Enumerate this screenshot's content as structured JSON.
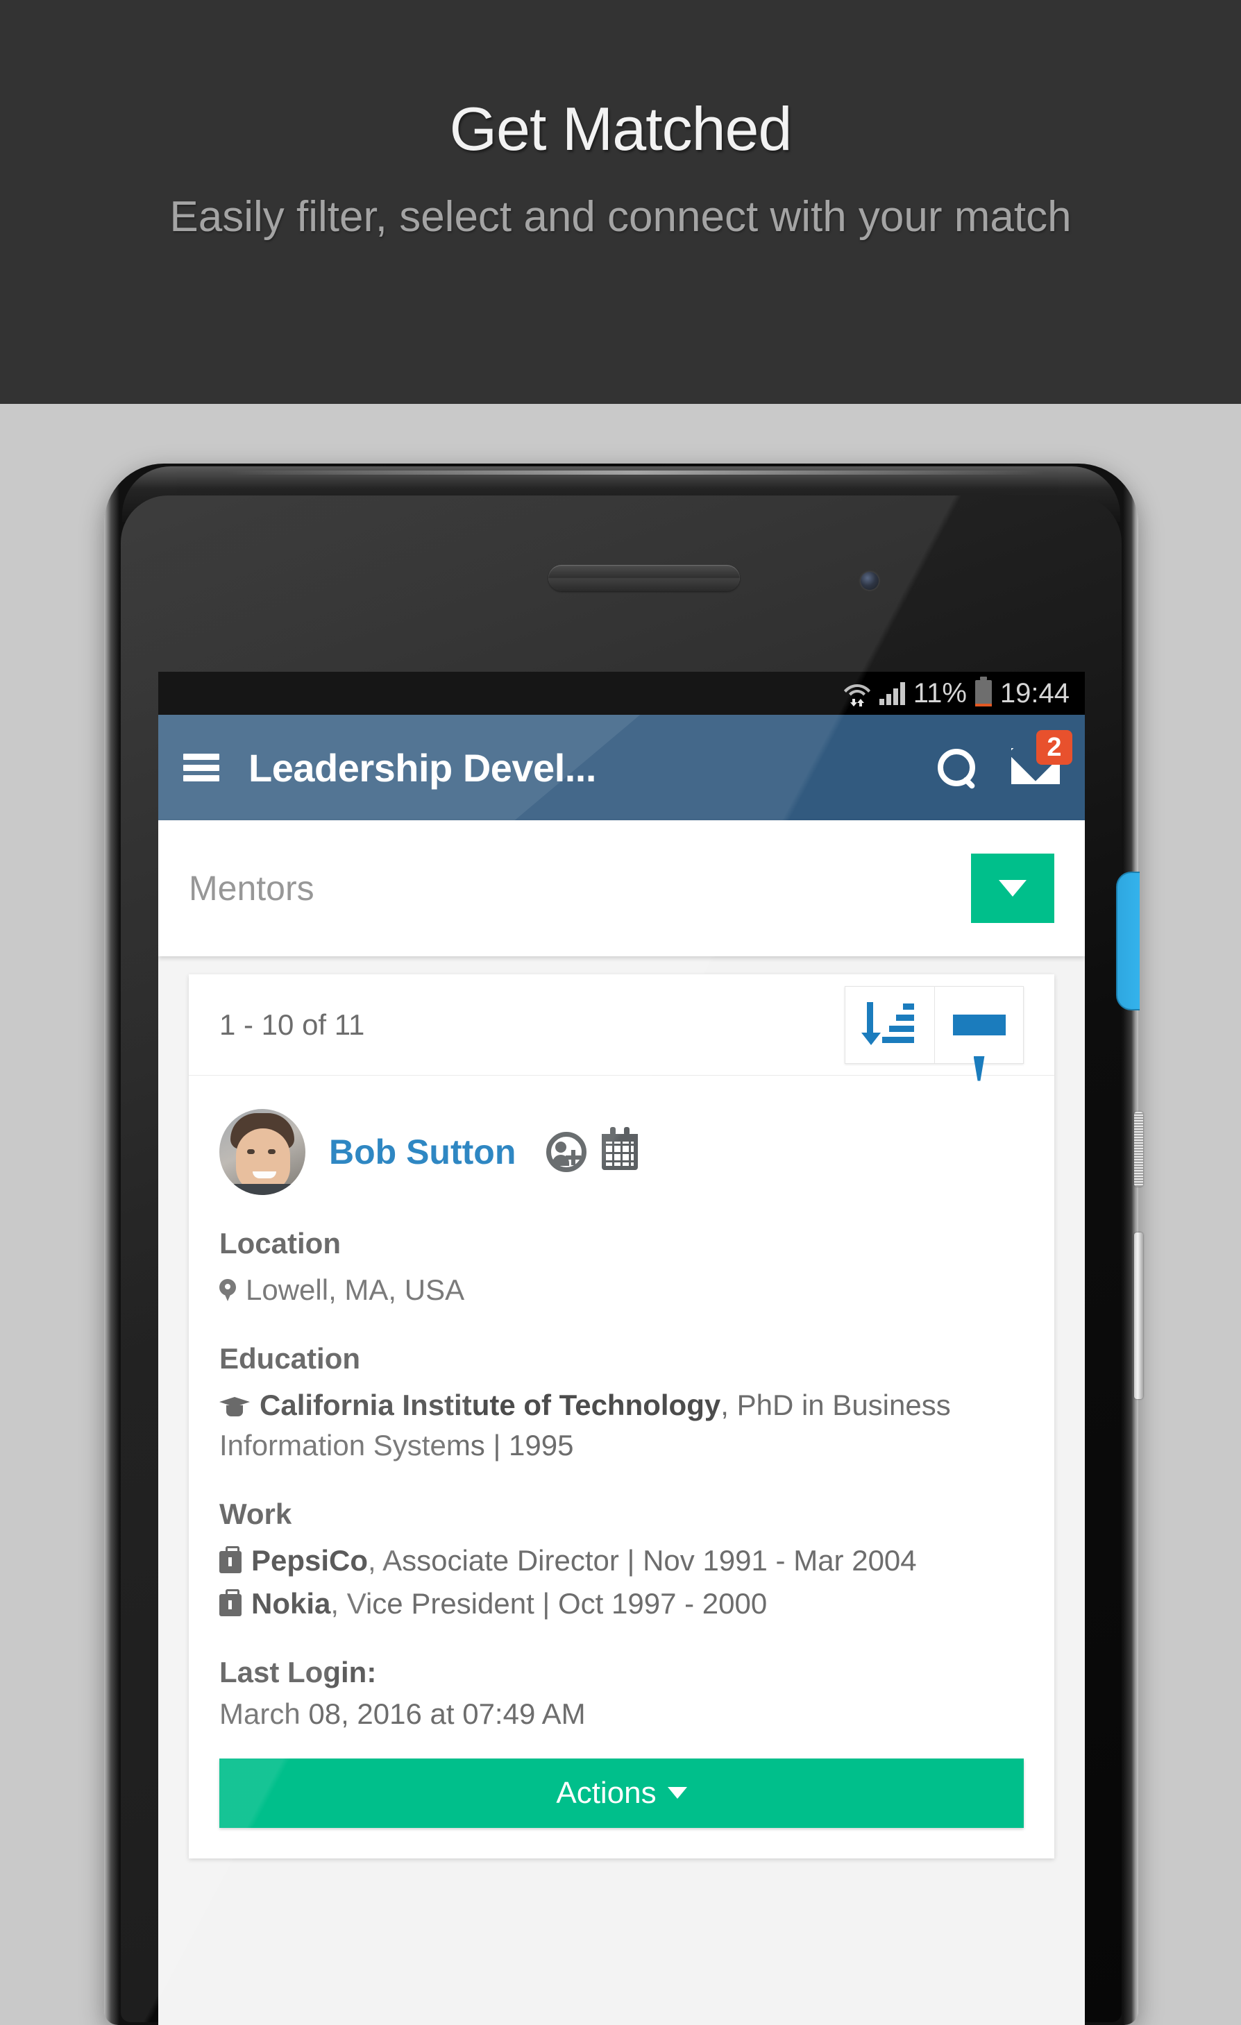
{
  "banner": {
    "title": "Get Matched",
    "subtitle": "Easily filter, select and connect with your match",
    "bg_color": "#333333",
    "title_color": "#f2f2f2",
    "subtitle_color": "#a4a4a4"
  },
  "statusbar": {
    "wifi_icon": "wifi-icon",
    "signal_icon": "cellular-signal-icon",
    "battery_percent": "11%",
    "battery_icon": "battery-icon",
    "clock": "19:44",
    "bg_color": "#000000",
    "text_color": "#d6d6d6",
    "battery_fill_color": "#e25822"
  },
  "appbar": {
    "menu_icon": "hamburger-menu-icon",
    "title": "Leadership Devel...",
    "search_icon": "search-icon",
    "mail_icon": "mail-icon",
    "mail_badge_count": "2",
    "bg_color": "#325a7f",
    "badge_color": "#e8512d"
  },
  "selector": {
    "label": "Mentors",
    "dropdown_icon": "chevron-down-icon",
    "button_color": "#00bf8b"
  },
  "list_toolbar": {
    "count_text": "1 - 10 of 11",
    "sort_icon": "sort-ascending-icon",
    "filter_icon": "filter-funnel-icon",
    "icon_color": "#1b7cbd"
  },
  "profile": {
    "avatar_icon": "avatar",
    "name": "Bob Sutton",
    "add_connection_icon": "add-user-icon",
    "calendar_icon": "calendar-icon",
    "name_color": "#1b7cbd",
    "sections": {
      "location_label": "Location",
      "location_icon": "location-pin-icon",
      "location_value": "Lowell, MA, USA",
      "education_label": "Education",
      "education_icon": "graduation-cap-icon",
      "education_school": "California Institute of Technology",
      "education_detail": ", PhD in Business Information Systems | 1995",
      "work_label": "Work",
      "work_entries": [
        {
          "icon": "briefcase-icon",
          "company": "PepsiCo",
          "detail": ", Associate Director | Nov 1991 - Mar 2004"
        },
        {
          "icon": "briefcase-icon",
          "company": "Nokia",
          "detail": ", Vice President | Oct 1997 - 2000"
        }
      ],
      "last_login_label": "Last Login:",
      "last_login_value": "March 08, 2016 at 07:49 AM"
    },
    "actions_label": "Actions",
    "actions_caret_icon": "caret-down-icon",
    "actions_color": "#00bf8b"
  },
  "device": {
    "earpiece_icon": "earpiece-speaker",
    "front_camera_icon": "front-camera",
    "power_button": "power-button",
    "volume_button": "volume-rocker",
    "feedback_tab": "side-feedback-tab"
  }
}
